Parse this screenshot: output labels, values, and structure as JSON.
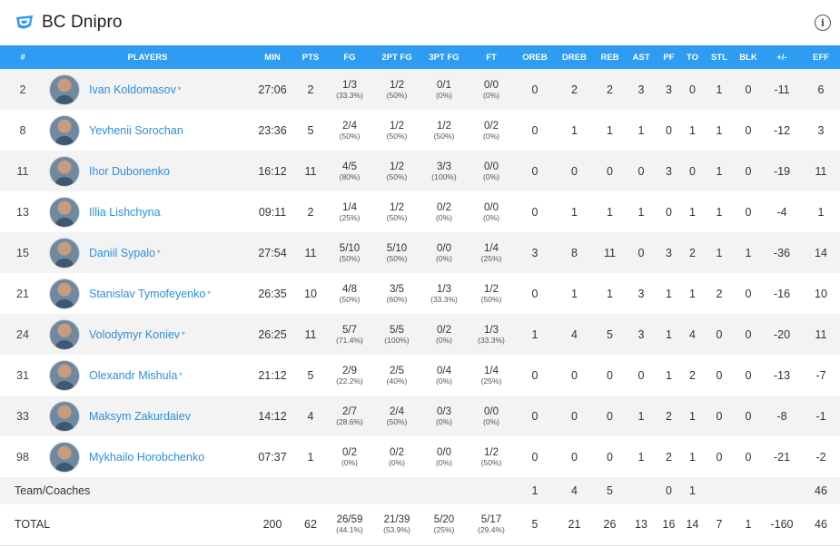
{
  "header": {
    "title": "BC Dnipro",
    "info_icon": "info-icon"
  },
  "columns": [
    "#",
    "PLAYERS",
    "MIN",
    "PTS",
    "FG",
    "2PT FG",
    "3PT FG",
    "FT",
    "OREB",
    "DREB",
    "REB",
    "AST",
    "PF",
    "TO",
    "STL",
    "BLK",
    "+/-",
    "EFF"
  ],
  "players": [
    {
      "num": "2",
      "name": "Ivan Koldomasov",
      "star": "*",
      "min": "27:06",
      "pts": "2",
      "fg": "1/3",
      "fg_pct": "(33.3%)",
      "fg2": "1/2",
      "fg2_pct": "(50%)",
      "fg3": "0/1",
      "fg3_pct": "(0%)",
      "ft": "0/0",
      "ft_pct": "(0%)",
      "oreb": "0",
      "dreb": "2",
      "reb": "2",
      "ast": "3",
      "pf": "3",
      "to": "0",
      "stl": "1",
      "blk": "0",
      "pm": "-11",
      "eff": "6"
    },
    {
      "num": "8",
      "name": "Yevhenii Sorochan",
      "star": "",
      "min": "23:36",
      "pts": "5",
      "fg": "2/4",
      "fg_pct": "(50%)",
      "fg2": "1/2",
      "fg2_pct": "(50%)",
      "fg3": "1/2",
      "fg3_pct": "(50%)",
      "ft": "0/2",
      "ft_pct": "(0%)",
      "oreb": "0",
      "dreb": "1",
      "reb": "1",
      "ast": "1",
      "pf": "0",
      "to": "1",
      "stl": "1",
      "blk": "0",
      "pm": "-12",
      "eff": "3"
    },
    {
      "num": "11",
      "name": "Ihor Dubonenko",
      "star": "",
      "min": "16:12",
      "pts": "11",
      "fg": "4/5",
      "fg_pct": "(80%)",
      "fg2": "1/2",
      "fg2_pct": "(50%)",
      "fg3": "3/3",
      "fg3_pct": "(100%)",
      "ft": "0/0",
      "ft_pct": "(0%)",
      "oreb": "0",
      "dreb": "0",
      "reb": "0",
      "ast": "0",
      "pf": "3",
      "to": "0",
      "stl": "1",
      "blk": "0",
      "pm": "-19",
      "eff": "11"
    },
    {
      "num": "13",
      "name": "Illia Lishchyna",
      "star": "",
      "min": "09:11",
      "pts": "2",
      "fg": "1/4",
      "fg_pct": "(25%)",
      "fg2": "1/2",
      "fg2_pct": "(50%)",
      "fg3": "0/2",
      "fg3_pct": "(0%)",
      "ft": "0/0",
      "ft_pct": "(0%)",
      "oreb": "0",
      "dreb": "1",
      "reb": "1",
      "ast": "1",
      "pf": "0",
      "to": "1",
      "stl": "1",
      "blk": "0",
      "pm": "-4",
      "eff": "1"
    },
    {
      "num": "15",
      "name": "Daniil Sypalo",
      "star": "*",
      "min": "27:54",
      "pts": "11",
      "fg": "5/10",
      "fg_pct": "(50%)",
      "fg2": "5/10",
      "fg2_pct": "(50%)",
      "fg3": "0/0",
      "fg3_pct": "(0%)",
      "ft": "1/4",
      "ft_pct": "(25%)",
      "oreb": "3",
      "dreb": "8",
      "reb": "11",
      "ast": "0",
      "pf": "3",
      "to": "2",
      "stl": "1",
      "blk": "1",
      "pm": "-36",
      "eff": "14"
    },
    {
      "num": "21",
      "name": "Stanislav Tymofeyenko",
      "star": "*",
      "min": "26:35",
      "pts": "10",
      "fg": "4/8",
      "fg_pct": "(50%)",
      "fg2": "3/5",
      "fg2_pct": "(60%)",
      "fg3": "1/3",
      "fg3_pct": "(33.3%)",
      "ft": "1/2",
      "ft_pct": "(50%)",
      "oreb": "0",
      "dreb": "1",
      "reb": "1",
      "ast": "3",
      "pf": "1",
      "to": "1",
      "stl": "2",
      "blk": "0",
      "pm": "-16",
      "eff": "10"
    },
    {
      "num": "24",
      "name": "Volodymyr Koniev",
      "star": "*",
      "min": "26:25",
      "pts": "11",
      "fg": "5/7",
      "fg_pct": "(71.4%)",
      "fg2": "5/5",
      "fg2_pct": "(100%)",
      "fg3": "0/2",
      "fg3_pct": "(0%)",
      "ft": "1/3",
      "ft_pct": "(33.3%)",
      "oreb": "1",
      "dreb": "4",
      "reb": "5",
      "ast": "3",
      "pf": "1",
      "to": "4",
      "stl": "0",
      "blk": "0",
      "pm": "-20",
      "eff": "11"
    },
    {
      "num": "31",
      "name": "Olexandr Mishula",
      "star": "*",
      "min": "21:12",
      "pts": "5",
      "fg": "2/9",
      "fg_pct": "(22.2%)",
      "fg2": "2/5",
      "fg2_pct": "(40%)",
      "fg3": "0/4",
      "fg3_pct": "(0%)",
      "ft": "1/4",
      "ft_pct": "(25%)",
      "oreb": "0",
      "dreb": "0",
      "reb": "0",
      "ast": "0",
      "pf": "1",
      "to": "2",
      "stl": "0",
      "blk": "0",
      "pm": "-13",
      "eff": "-7"
    },
    {
      "num": "33",
      "name": "Maksym Zakurdaiev",
      "star": "",
      "min": "14:12",
      "pts": "4",
      "fg": "2/7",
      "fg_pct": "(28.6%)",
      "fg2": "2/4",
      "fg2_pct": "(50%)",
      "fg3": "0/3",
      "fg3_pct": "(0%)",
      "ft": "0/0",
      "ft_pct": "(0%)",
      "oreb": "0",
      "dreb": "0",
      "reb": "0",
      "ast": "1",
      "pf": "2",
      "to": "1",
      "stl": "0",
      "blk": "0",
      "pm": "-8",
      "eff": "-1"
    },
    {
      "num": "98",
      "name": "Mykhailo Horobchenko",
      "star": "",
      "min": "07:37",
      "pts": "1",
      "fg": "0/2",
      "fg_pct": "(0%)",
      "fg2": "0/2",
      "fg2_pct": "(0%)",
      "fg3": "0/0",
      "fg3_pct": "(0%)",
      "ft": "1/2",
      "ft_pct": "(50%)",
      "oreb": "0",
      "dreb": "0",
      "reb": "0",
      "ast": "1",
      "pf": "2",
      "to": "1",
      "stl": "0",
      "blk": "0",
      "pm": "-21",
      "eff": "-2"
    }
  ],
  "team_row": {
    "label": "Team/Coaches",
    "oreb": "1",
    "dreb": "4",
    "reb": "5",
    "pf": "0",
    "to": "1",
    "eff": "46"
  },
  "total_row": {
    "label": "TOTAL",
    "min": "200",
    "pts": "62",
    "fg": "26/59",
    "fg_pct": "(44.1%)",
    "fg2": "21/39",
    "fg2_pct": "(53.9%)",
    "fg3": "5/20",
    "fg3_pct": "(25%)",
    "ft": "5/17",
    "ft_pct": "(29.4%)",
    "oreb": "5",
    "dreb": "21",
    "reb": "26",
    "ast": "13",
    "pf": "16",
    "to": "14",
    "stl": "7",
    "blk": "1",
    "pm": "-160",
    "eff": "46"
  },
  "colors": {
    "header_blue": "#2e9cf2",
    "link_blue": "#2d8fe0",
    "row_alt": "#f3f3f3"
  }
}
